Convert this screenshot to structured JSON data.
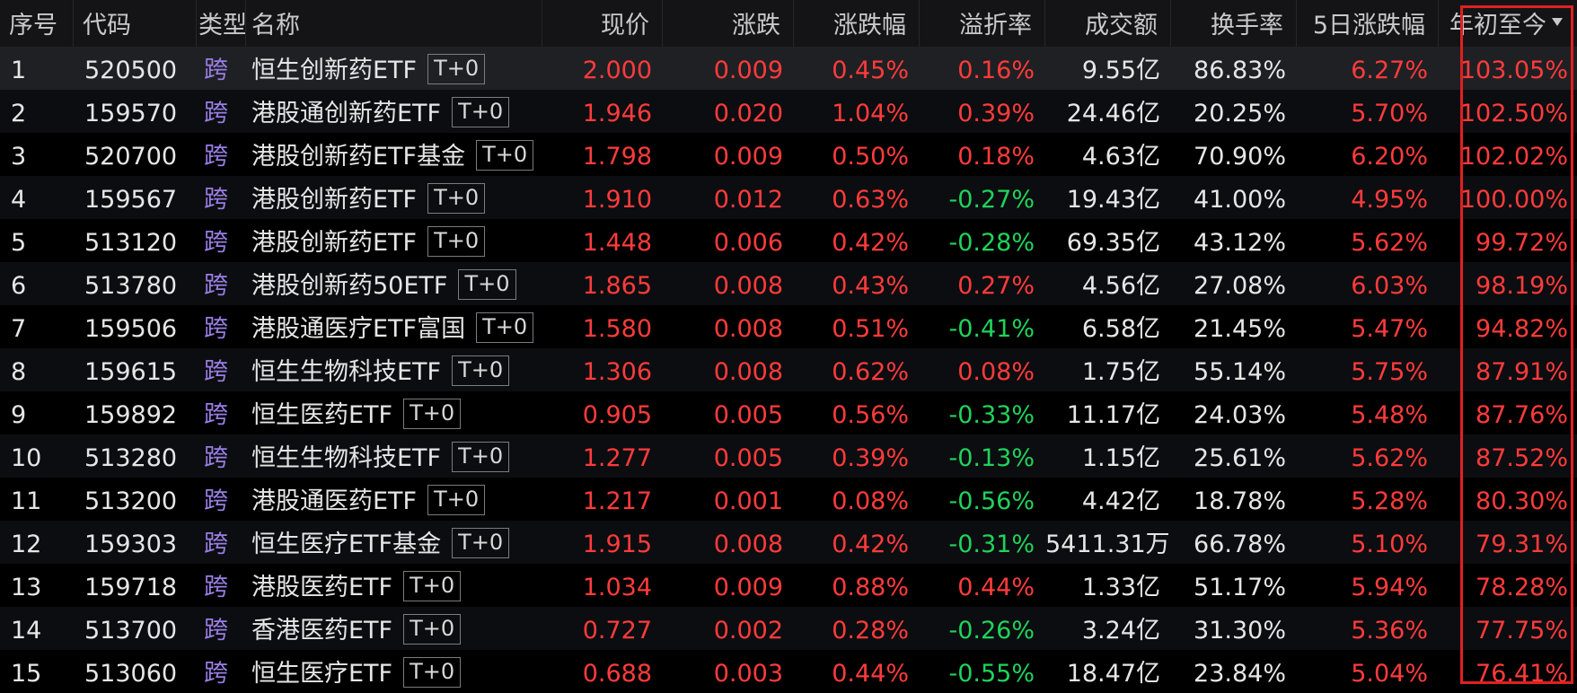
{
  "colors": {
    "up": "#ff3b3b",
    "down": "#1fd35a",
    "type_label": "#9a7ee6",
    "highlight_box": "#e02020"
  },
  "header": {
    "seq": "序号",
    "code": "代码",
    "type": "类型",
    "name": "名称",
    "price": "现价",
    "change": "涨跌",
    "change_pct": "涨跌幅",
    "premium": "溢折率",
    "turnover_amount": "成交额",
    "turnover_rate": "换手率",
    "five_day_pct": "5日涨跌幅",
    "ytd": "年初至今",
    "ytd_sort_icon": "sort-descending-icon"
  },
  "rows": [
    {
      "seq": "1",
      "code": "520500",
      "type": "跨",
      "name": "恒生创新药ETF",
      "tag": "T+0",
      "price": "2.000",
      "change": "0.009",
      "change_pct": "0.45%",
      "premium": "0.16%",
      "turnover_amount": "9.55亿",
      "turnover_rate": "86.83%",
      "five_day_pct": "6.27%",
      "ytd": "103.05%"
    },
    {
      "seq": "2",
      "code": "159570",
      "type": "跨",
      "name": "港股通创新药ETF",
      "tag": "T+0",
      "price": "1.946",
      "change": "0.020",
      "change_pct": "1.04%",
      "premium": "0.39%",
      "turnover_amount": "24.46亿",
      "turnover_rate": "20.25%",
      "five_day_pct": "5.70%",
      "ytd": "102.50%"
    },
    {
      "seq": "3",
      "code": "520700",
      "type": "跨",
      "name": "港股创新药ETF基金",
      "tag": "T+0",
      "price": "1.798",
      "change": "0.009",
      "change_pct": "0.50%",
      "premium": "0.18%",
      "turnover_amount": "4.63亿",
      "turnover_rate": "70.90%",
      "five_day_pct": "6.20%",
      "ytd": "102.02%"
    },
    {
      "seq": "4",
      "code": "159567",
      "type": "跨",
      "name": "港股创新药ETF",
      "tag": "T+0",
      "price": "1.910",
      "change": "0.012",
      "change_pct": "0.63%",
      "premium": "-0.27%",
      "turnover_amount": "19.43亿",
      "turnover_rate": "41.00%",
      "five_day_pct": "4.95%",
      "ytd": "100.00%"
    },
    {
      "seq": "5",
      "code": "513120",
      "type": "跨",
      "name": "港股创新药ETF",
      "tag": "T+0",
      "price": "1.448",
      "change": "0.006",
      "change_pct": "0.42%",
      "premium": "-0.28%",
      "turnover_amount": "69.35亿",
      "turnover_rate": "43.12%",
      "five_day_pct": "5.62%",
      "ytd": "99.72%"
    },
    {
      "seq": "6",
      "code": "513780",
      "type": "跨",
      "name": "港股创新药50ETF",
      "tag": "T+0",
      "price": "1.865",
      "change": "0.008",
      "change_pct": "0.43%",
      "premium": "0.27%",
      "turnover_amount": "4.56亿",
      "turnover_rate": "27.08%",
      "five_day_pct": "6.03%",
      "ytd": "98.19%"
    },
    {
      "seq": "7",
      "code": "159506",
      "type": "跨",
      "name": "港股通医疗ETF富国",
      "tag": "T+0",
      "price": "1.580",
      "change": "0.008",
      "change_pct": "0.51%",
      "premium": "-0.41%",
      "turnover_amount": "6.58亿",
      "turnover_rate": "21.45%",
      "five_day_pct": "5.47%",
      "ytd": "94.82%"
    },
    {
      "seq": "8",
      "code": "159615",
      "type": "跨",
      "name": "恒生生物科技ETF",
      "tag": "T+0",
      "price": "1.306",
      "change": "0.008",
      "change_pct": "0.62%",
      "premium": "0.08%",
      "turnover_amount": "1.75亿",
      "turnover_rate": "55.14%",
      "five_day_pct": "5.75%",
      "ytd": "87.91%"
    },
    {
      "seq": "9",
      "code": "159892",
      "type": "跨",
      "name": "恒生医药ETF",
      "tag": "T+0",
      "price": "0.905",
      "change": "0.005",
      "change_pct": "0.56%",
      "premium": "-0.33%",
      "turnover_amount": "11.17亿",
      "turnover_rate": "24.03%",
      "five_day_pct": "5.48%",
      "ytd": "87.76%"
    },
    {
      "seq": "10",
      "code": "513280",
      "type": "跨",
      "name": "恒生生物科技ETF",
      "tag": "T+0",
      "price": "1.277",
      "change": "0.005",
      "change_pct": "0.39%",
      "premium": "-0.13%",
      "turnover_amount": "1.15亿",
      "turnover_rate": "25.61%",
      "five_day_pct": "5.62%",
      "ytd": "87.52%"
    },
    {
      "seq": "11",
      "code": "513200",
      "type": "跨",
      "name": "港股通医药ETF",
      "tag": "T+0",
      "price": "1.217",
      "change": "0.001",
      "change_pct": "0.08%",
      "premium": "-0.56%",
      "turnover_amount": "4.42亿",
      "turnover_rate": "18.78%",
      "five_day_pct": "5.28%",
      "ytd": "80.30%"
    },
    {
      "seq": "12",
      "code": "159303",
      "type": "跨",
      "name": "恒生医疗ETF基金",
      "tag": "T+0",
      "price": "1.915",
      "change": "0.008",
      "change_pct": "0.42%",
      "premium": "-0.31%",
      "turnover_amount": "5411.31万",
      "turnover_rate": "66.78%",
      "five_day_pct": "5.10%",
      "ytd": "79.31%"
    },
    {
      "seq": "13",
      "code": "159718",
      "type": "跨",
      "name": "港股医药ETF",
      "tag": "T+0",
      "price": "1.034",
      "change": "0.009",
      "change_pct": "0.88%",
      "premium": "0.44%",
      "turnover_amount": "1.33亿",
      "turnover_rate": "51.17%",
      "five_day_pct": "5.94%",
      "ytd": "78.28%"
    },
    {
      "seq": "14",
      "code": "513700",
      "type": "跨",
      "name": "香港医药ETF",
      "tag": "T+0",
      "price": "0.727",
      "change": "0.002",
      "change_pct": "0.28%",
      "premium": "-0.26%",
      "turnover_amount": "3.24亿",
      "turnover_rate": "31.30%",
      "five_day_pct": "5.36%",
      "ytd": "77.75%"
    },
    {
      "seq": "15",
      "code": "513060",
      "type": "跨",
      "name": "恒生医疗ETF",
      "tag": "T+0",
      "price": "0.688",
      "change": "0.003",
      "change_pct": "0.44%",
      "premium": "-0.55%",
      "turnover_amount": "18.47亿",
      "turnover_rate": "23.84%",
      "five_day_pct": "5.04%",
      "ytd": "76.41%"
    }
  ]
}
